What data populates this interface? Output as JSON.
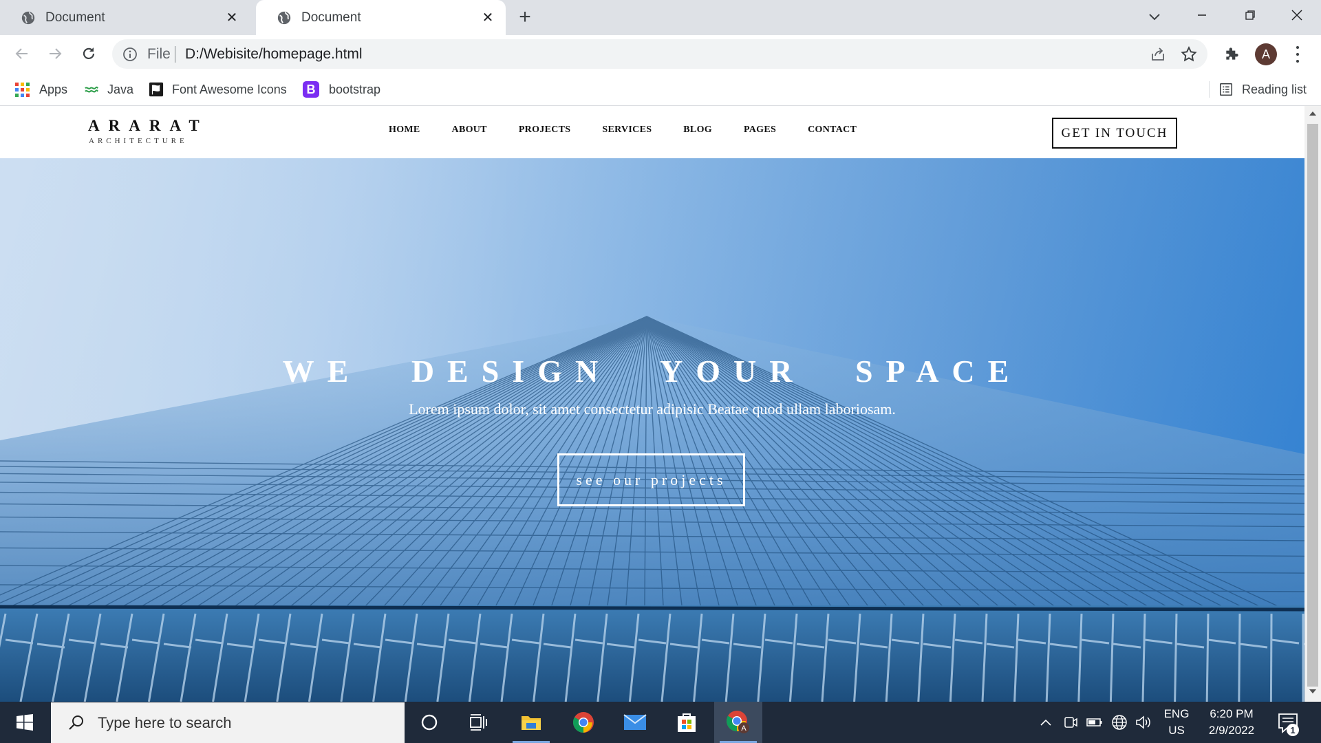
{
  "browser": {
    "tabs": [
      {
        "title": "Document",
        "active": false
      },
      {
        "title": "Document",
        "active": true
      }
    ],
    "omnibox": {
      "scheme_label": "File",
      "url": "D:/Webisite/homepage.html"
    },
    "profile_initial": "A",
    "bookmarks": [
      {
        "label": "Apps",
        "icon": "apps-grid-icon"
      },
      {
        "label": "Java",
        "icon": "java-icon"
      },
      {
        "label": "Font Awesome Icons",
        "icon": "flag-icon"
      },
      {
        "label": "bootstrap",
        "icon": "bootstrap-icon",
        "icon_text": "B"
      }
    ],
    "reading_list": "Reading list"
  },
  "site": {
    "logo": {
      "name": "ARARAT",
      "tagline": "ARCHITECTURE"
    },
    "nav": [
      "HOME",
      "ABOUT",
      "PROJECTS",
      "SERVICES",
      "BLOG",
      "PAGES",
      "CONTACT"
    ],
    "cta": "GET IN TOUCH",
    "hero": {
      "title": "WE DESIGN YOUR SPACE",
      "subtitle": "Lorem ipsum dolor, sit amet consectetur adipisic Beatae quod ullam laboriosam.",
      "button": "see our projects"
    }
  },
  "taskbar": {
    "search_placeholder": "Type here to search",
    "language": {
      "line1": "ENG",
      "line2": "US"
    },
    "time": "6:20 PM",
    "date": "2/9/2022",
    "notification_count": "1"
  },
  "colors": {
    "taskbar_bg": "#1f2a3a",
    "tabstrip_bg": "#dee1e6",
    "hero_sky": "#2f7fd0",
    "bootstrap_purple": "#7b2df2"
  }
}
